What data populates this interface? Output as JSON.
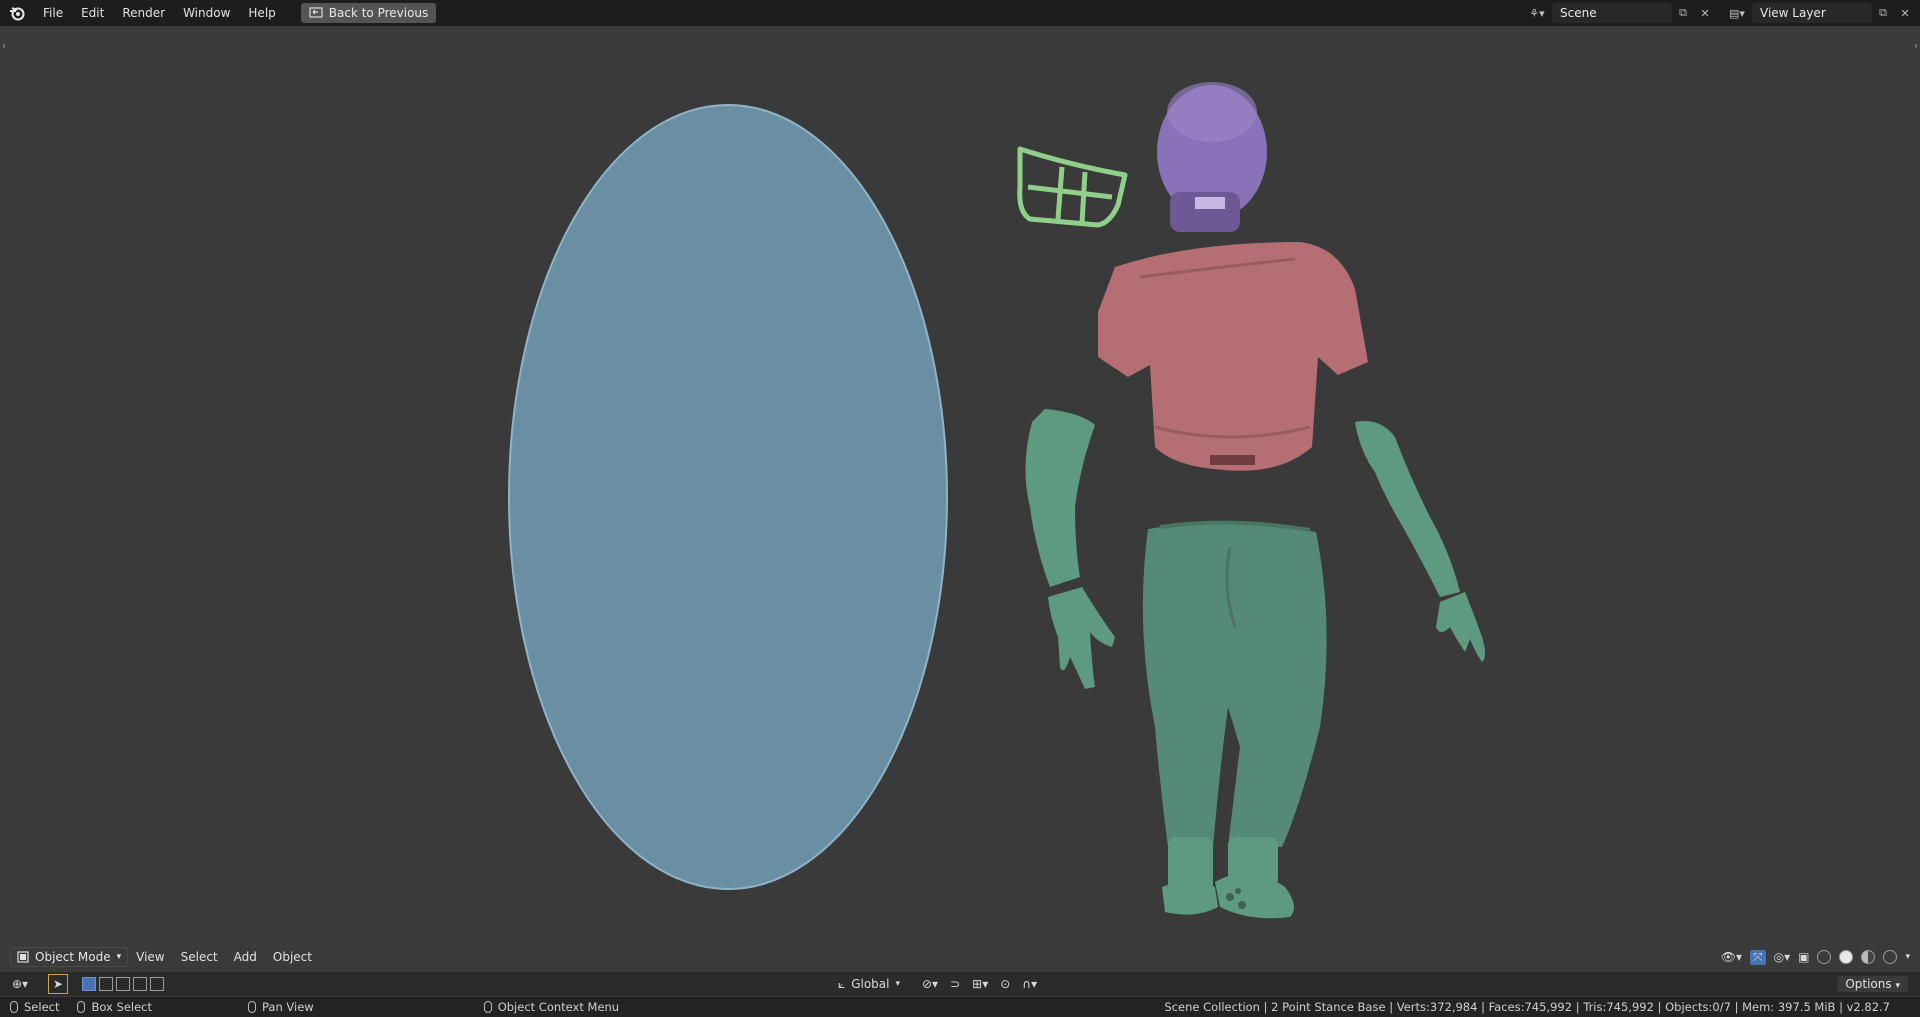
{
  "topbar": {
    "menu": [
      "File",
      "Edit",
      "Render",
      "Window",
      "Help"
    ],
    "back_label": "Back to Previous",
    "scene_value": "Scene",
    "view_layer_value": "View Layer"
  },
  "viewport_header": {
    "mode": "Object Mode",
    "menu": [
      "View",
      "Select",
      "Add",
      "Object"
    ]
  },
  "tool_header": {
    "transform_orientation": "Global",
    "options_label": "Options"
  },
  "statusbar": {
    "select": "Select",
    "box_select": "Box Select",
    "pan_view": "Pan View",
    "context_menu": "Object Context Menu",
    "stats": "Scene Collection | 2 Point Stance Base | Verts:372,984 | Faces:745,992 | Tris:745,992 | Objects:0/7 | Mem: 397.5 MiB | v2.82.7"
  },
  "colors": {
    "base_disc": "#6a8fa3",
    "helmet": "#8a72b8",
    "facemask": "#8fcf8a",
    "jersey": "#b56f74",
    "limbs": "#5e9a80",
    "pants": "#568a78"
  },
  "icons": {
    "logo": "blender-logo-icon",
    "back": "back-screen-icon",
    "scene": "scene-icon",
    "view_layer": "view-layer-icon"
  }
}
